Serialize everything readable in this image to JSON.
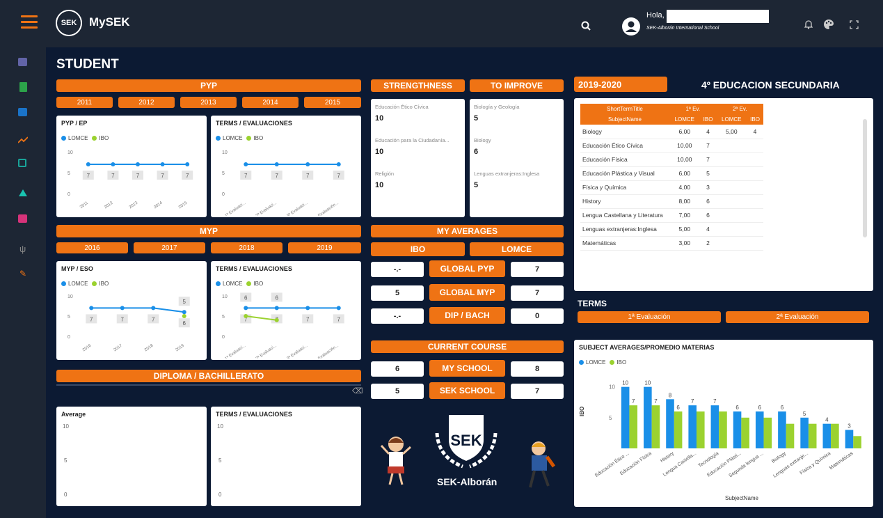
{
  "app": {
    "name": "MySEK",
    "logo_text": "SEK",
    "greeting": "Hola,",
    "school": "SEK-Alborán International School"
  },
  "colors": {
    "orange": "#ef7314",
    "blue": "#1a8fe8",
    "green": "#9bd22f",
    "bg": "#0c1a33",
    "topbar": "#1d2634"
  },
  "topbar_icons": [
    "menu-icon",
    "search-icon",
    "user-avatar-icon",
    "bell-icon",
    "palette-icon",
    "fullscreen-icon"
  ],
  "sidebar_icons": [
    "teams-icon",
    "book-icon",
    "outlook-icon",
    "trend-icon",
    "grades-icon",
    "onenote-icon",
    "calendar-icon",
    "tools-icon",
    "pencil-icon"
  ],
  "page": {
    "title": "STUDENT"
  },
  "pyp": {
    "header": "PYP",
    "years": [
      "2011",
      "2012",
      "2013",
      "2014",
      "2015"
    ],
    "chart1": {
      "title": "PYP / EP",
      "legend": [
        "LOMCE",
        "IBO"
      ],
      "yticks": [
        "10",
        "5",
        "0"
      ],
      "x": [
        "2011",
        "2012",
        "2013",
        "2014",
        "2015"
      ],
      "lomce": [
        7,
        7,
        7,
        7,
        7
      ],
      "labels": [
        "7",
        "7",
        "7",
        "7",
        "7"
      ]
    },
    "chart2": {
      "title": "TERMS / EVALUACIONES",
      "legend": [
        "LOMCE",
        "IBO"
      ],
      "yticks": [
        "10",
        "5",
        "0"
      ],
      "x": [
        "1ª Evaluaci...",
        "2ª Evaluaci...",
        "3ª Evaluaci...",
        "Evaluación..."
      ],
      "lomce": [
        7,
        7,
        7,
        7
      ],
      "labels": [
        "7",
        "7",
        "7",
        "7"
      ]
    }
  },
  "myp": {
    "header": "MYP",
    "years": [
      "2016",
      "2017",
      "2018",
      "2019"
    ],
    "chart1": {
      "title": "MYP / ESO",
      "legend": [
        "LOMCE",
        "IBO"
      ],
      "yticks": [
        "10",
        "5",
        "0"
      ],
      "x": [
        "2016",
        "2017",
        "2018",
        "2019"
      ],
      "lomce": [
        7,
        7,
        7,
        6
      ],
      "ibo": [
        null,
        null,
        null,
        5
      ],
      "labels": [
        "7",
        "7",
        "7",
        "6"
      ],
      "ibo_label": "5"
    },
    "chart2": {
      "title": "TERMS / EVALUACIONES",
      "legend": [
        "LOMCE",
        "IBO"
      ],
      "yticks": [
        "10",
        "5",
        "0"
      ],
      "x": [
        "1ª Evaluaci...",
        "2ª Evaluaci...",
        "3ª Evaluaci...",
        "Evaluación..."
      ],
      "lomce": [
        7,
        7,
        7,
        7
      ],
      "ibo": [
        5,
        4,
        null,
        null
      ],
      "labels": [
        "7",
        "7",
        "7",
        "7"
      ],
      "ibo_labels": [
        "6",
        "6"
      ]
    }
  },
  "diploma": {
    "header": "DIPLOMA / BACHILLERATO",
    "chart1": {
      "title": "Average",
      "yticks": [
        "10",
        "5",
        "0"
      ]
    },
    "chart2": {
      "title": "TERMS / EVALUACIONES",
      "yticks": [
        "10",
        "5",
        "0"
      ]
    }
  },
  "strengths": {
    "header": "STRENGTHNESS",
    "items": [
      {
        "label": "Educación Ético Cívica",
        "value": "10"
      },
      {
        "label": "Educación para la Ciudadanía...",
        "value": "10"
      },
      {
        "label": "Religión",
        "value": "10"
      }
    ]
  },
  "improve": {
    "header": "TO IMPROVE",
    "items": [
      {
        "label": "Biología y Geología",
        "value": "5"
      },
      {
        "label": "Biology",
        "value": "6"
      },
      {
        "label": "Lenguas extranjeras:Inglesa",
        "value": "5"
      }
    ]
  },
  "averages": {
    "header": "MY AVERAGES",
    "ibo_label": "IBO",
    "lomce_label": "LOMCE",
    "rows": [
      {
        "label": "GLOBAL PYP",
        "ibo": "-.-",
        "lomce": "7"
      },
      {
        "label": "GLOBAL MYP",
        "ibo": "5",
        "lomce": "7"
      },
      {
        "label": "DIP / BACH",
        "ibo": "-.-",
        "lomce": "0"
      }
    ]
  },
  "current": {
    "header": "CURRENT COURSE",
    "rows": [
      {
        "label": "MY SCHOOL",
        "left": "6",
        "right": "8"
      },
      {
        "label": "SEK SCHOOL",
        "left": "5",
        "right": "7"
      }
    ]
  },
  "brand": {
    "name": "SEK-Alborán",
    "logo": "SEK"
  },
  "course": {
    "year": "2019-2020",
    "level": "4º EDUCACION SECUNDARIA"
  },
  "grades": {
    "header1": "ShortTermTitle",
    "header2": "SubjectName",
    "terms": [
      "1ª Ev.",
      "2ª Ev."
    ],
    "cols": [
      "LOMCE",
      "IBO",
      "LOMCE",
      "IBO"
    ],
    "rows": [
      [
        "Biology",
        "6,00",
        "4",
        "5,00",
        "4"
      ],
      [
        "Educación Ético Cívica",
        "10,00",
        "7",
        "",
        ""
      ],
      [
        "Educación Física",
        "10,00",
        "7",
        "",
        ""
      ],
      [
        "Educación Plástica y Visual",
        "6,00",
        "5",
        "",
        ""
      ],
      [
        "Física y Química",
        "4,00",
        "3",
        "",
        ""
      ],
      [
        "History",
        "8,00",
        "6",
        "",
        ""
      ],
      [
        "Lengua Castellana y Literatura",
        "7,00",
        "6",
        "",
        ""
      ],
      [
        "Lenguas extranjeras:Inglesa",
        "5,00",
        "4",
        "",
        ""
      ],
      [
        "Matemáticas",
        "3,00",
        "2",
        "",
        ""
      ]
    ]
  },
  "terms": {
    "header": "TERMS",
    "buttons": [
      "1ª Evaluación",
      "2ª Evaluación"
    ]
  },
  "chart_data": {
    "type": "bar",
    "title": "SUBJECT AVERAGES/PROMEDIO MATERIAS",
    "ylabel": "IBO",
    "xlabel": "SubjectName",
    "ylim": [
      0,
      12
    ],
    "yticks": [
      "10",
      "5"
    ],
    "categories": [
      "Educación Ético ...",
      "Educación Física",
      "History",
      "Lengua Castella...",
      "Tecnología",
      "Educación Plásti...",
      "Segunda lengua ...",
      "Biology",
      "Lenguas extranje...",
      "Física y Química",
      "Matemáticas"
    ],
    "series": [
      {
        "name": "LOMCE",
        "values": [
          10,
          10,
          8,
          7,
          7,
          6,
          6,
          6,
          5,
          4,
          3
        ]
      },
      {
        "name": "IBO",
        "values": [
          7,
          7,
          6,
          6,
          6,
          5,
          5,
          4,
          4,
          4,
          2
        ]
      }
    ],
    "value_labels": [
      [
        "10",
        "7"
      ],
      [
        "10",
        "7"
      ],
      [
        "8",
        "6"
      ],
      [
        "7",
        ""
      ],
      [
        "7",
        ""
      ],
      [
        "6",
        ""
      ],
      [
        "6",
        ""
      ],
      [
        "6",
        ""
      ],
      [
        "5",
        ""
      ],
      [
        "4",
        ""
      ],
      [
        "3",
        ""
      ]
    ],
    "legend": [
      "LOMCE",
      "IBO"
    ]
  }
}
